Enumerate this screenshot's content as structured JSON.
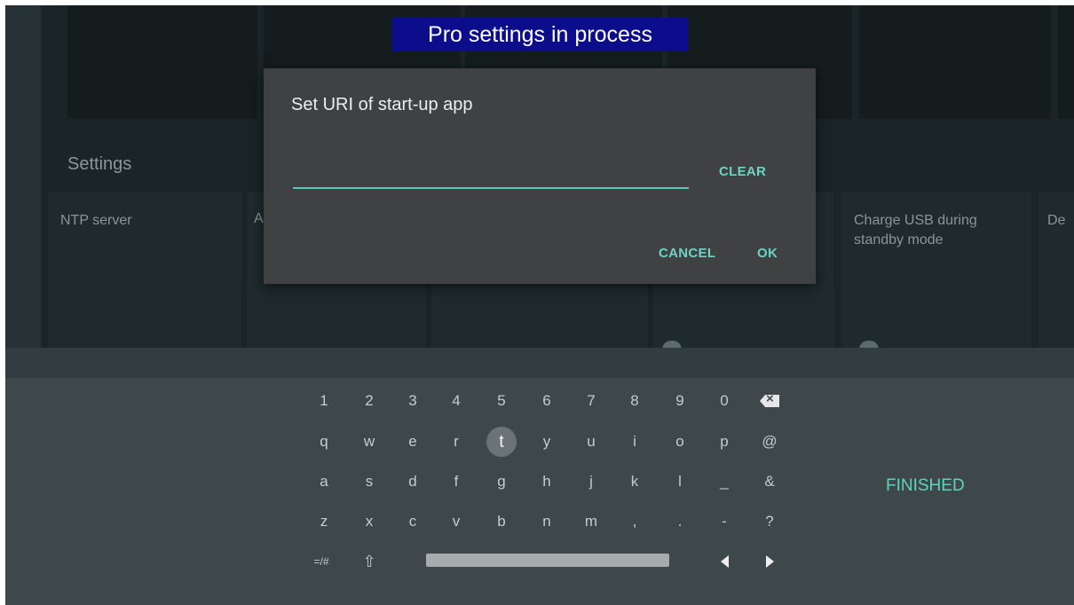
{
  "banner": {
    "text": "Pro settings in process"
  },
  "background": {
    "section_label": "Settings",
    "tiles": [
      {
        "label": "NTP server"
      },
      {
        "label": "A"
      },
      {
        "label": "Charge USB during standby mode"
      },
      {
        "label": "De"
      }
    ]
  },
  "dialog": {
    "title": "Set URI of start-up app",
    "input_value": "",
    "clear_label": "CLEAR",
    "cancel_label": "CANCEL",
    "ok_label": "OK"
  },
  "keyboard": {
    "focused_key": "t",
    "rows": [
      [
        "1",
        "2",
        "3",
        "4",
        "5",
        "6",
        "7",
        "8",
        "9",
        "0"
      ],
      [
        "q",
        "w",
        "e",
        "r",
        "t",
        "y",
        "u",
        "i",
        "o",
        "p",
        "@"
      ],
      [
        "a",
        "s",
        "d",
        "f",
        "g",
        "h",
        "j",
        "k",
        "l",
        "_",
        "&"
      ],
      [
        "z",
        "x",
        "c",
        "v",
        "b",
        "n",
        "m",
        ",",
        ".",
        "-",
        "?"
      ]
    ],
    "symbols_key": "=/#",
    "shift_icon": "shift-icon",
    "backspace_icon": "backspace-icon",
    "left_arrow_icon": "arrow-left-icon",
    "right_arrow_icon": "arrow-right-icon",
    "finished_label": "FINISHED"
  },
  "colors": {
    "accent": "#5fd3c0",
    "banner_bg": "#0b0d8c",
    "dialog_bg": "#3f4142",
    "keyboard_bg": "#3e474a"
  }
}
